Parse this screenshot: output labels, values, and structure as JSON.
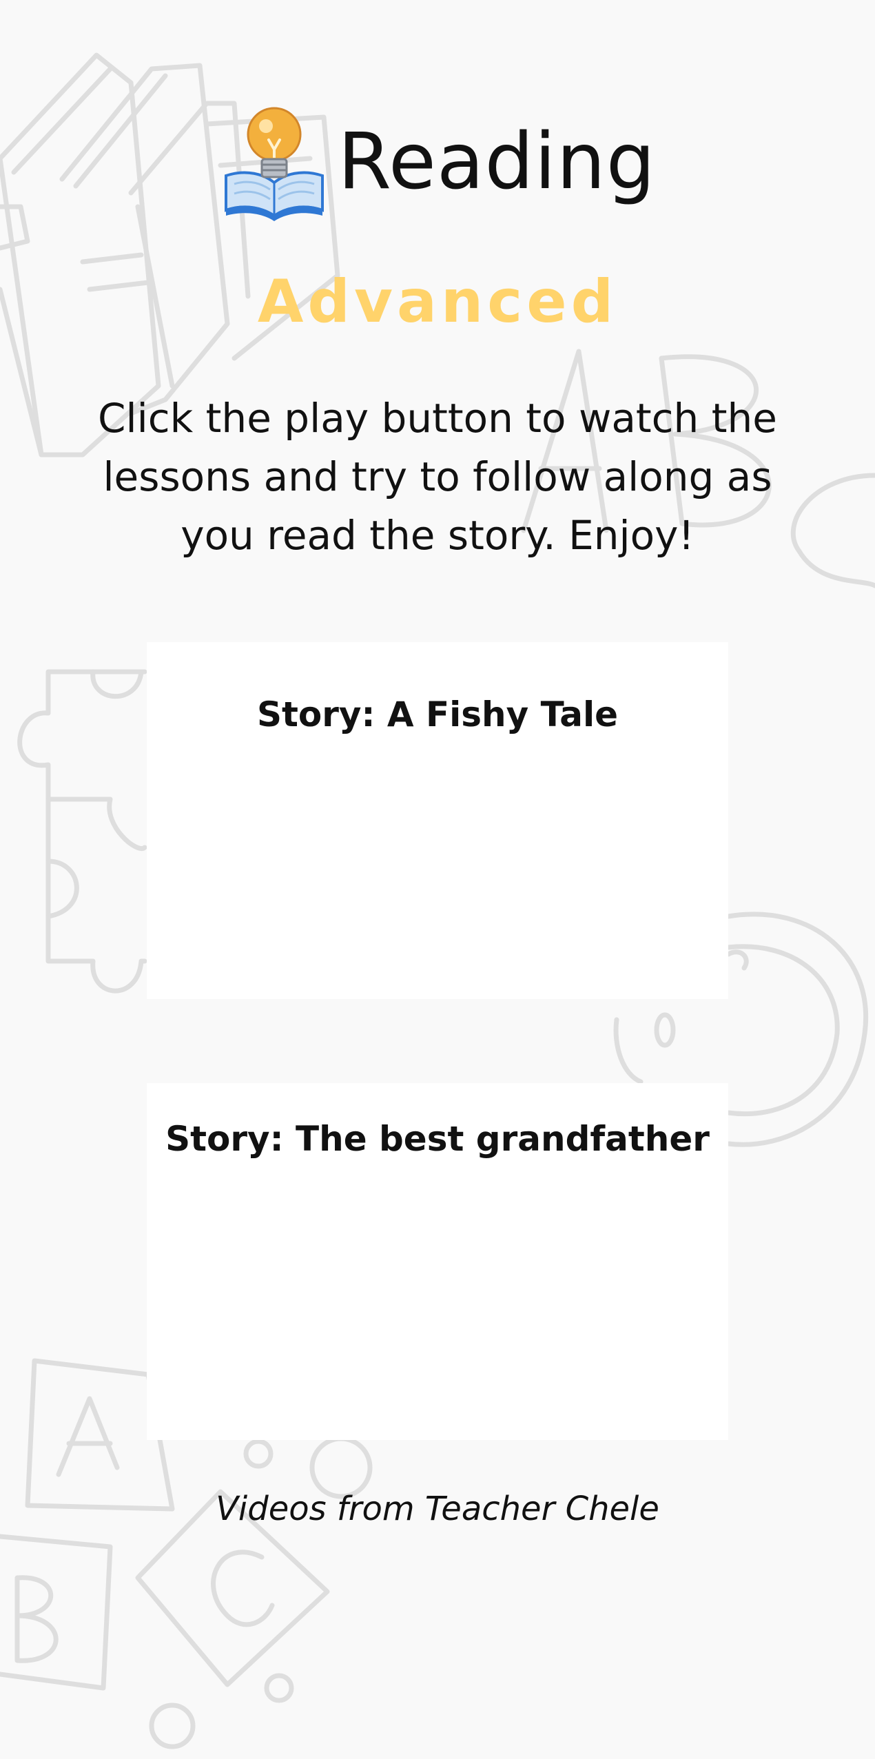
{
  "header": {
    "logo_icon": "book-lightbulb-icon",
    "title": "Reading"
  },
  "level": "Advanced",
  "intro": "Click the play button to watch the lessons and try to follow along as you read the story. Enjoy!",
  "stories": [
    {
      "title": "Story: A Fishy Tale"
    },
    {
      "title": "Story: The best grandfather"
    }
  ],
  "footer": {
    "credit": "Videos from  Teacher Chele"
  },
  "colors": {
    "background": "#f9f9f9",
    "accent": "#ffd36b",
    "text": "#111111",
    "card": "#ffffff",
    "doodle": "#dcdcdc"
  }
}
